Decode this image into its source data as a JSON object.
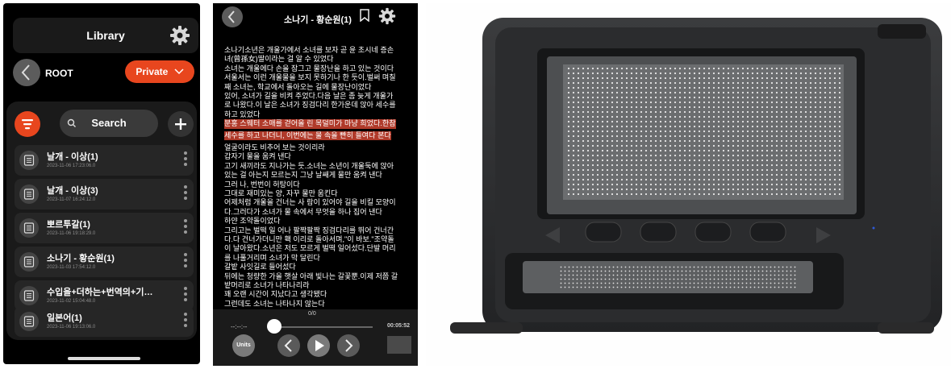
{
  "library": {
    "title": "Library",
    "root_label": "ROOT",
    "private_label": "Private",
    "search_label": "Search",
    "icons": [
      "gear-icon",
      "back-icon",
      "chevron-down-icon",
      "filter-icon",
      "search-icon",
      "plus-icon",
      "document-icon",
      "kebab-icon"
    ],
    "accent_color": "#e8461e",
    "items": [
      {
        "name": "날개 - 이상(1)",
        "date": "2023-11-06 17:23:06.0"
      },
      {
        "name": "날개 - 이상(3)",
        "date": "2023-11-07 16:24:12.0"
      },
      {
        "name": "뽀르투갈(1)",
        "date": "2023-11-06 19:18:29.0"
      },
      {
        "name": "소나기 - 황순원(1)",
        "date": "2023-11-03 17:54:12.0"
      },
      {
        "name": "수입을+더하는+번역의+기…",
        "date": "2023-11-02 15:04:48.0"
      },
      {
        "name": "일본어(1)",
        "date": "2023-11-06 19:13:06.0"
      }
    ]
  },
  "reader": {
    "title": "소나기 - 황순원(1)",
    "lines": [
      "소나기소년은 개울가에서 소녀를 보자 곧 윤 초시네 증손",
      "녀(曾孫女)딸이라는 걸 알 수 있었다",
      "소녀는 개울에다 손을 잠그고 물장난을 하고 있는 것이다",
      "서울서는 이런 개울물을 보지 못하기나 한 듯이.벌써 며칠",
      "째 소녀는, 학교에서 돌아오는 길에 물장난이었다",
      "있어, 소녀가 길을 비켜 주었다.다음 날은 좀 늦게 개울가",
      "로 나왔다.이 날은 소녀가 징검다리 한가운데 앉아 세수를",
      "하고 있었다",
      "분홍 스웨터 소매를 걷어올 린 목덜미가 마냥 희었다.한참",
      "세수를 하고 나더니, 이번에는 물 속을 빤히 들여다 본다",
      "얼굴이라도 비추어 보는 것이리라",
      "갑자기 물을 움켜 낸다",
      "고기 새끼라도 지나가는 듯.소녀는 소년이 개울둑에 앉아",
      "있는 걸 아는지 모르는지 그냥 날쌔게 물만 움켜 낸다",
      "그러 나, 번번이 허탕이다",
      "그대로 재미있는 양, 자꾸 물만 움킨다",
      "어제처럼 개울을 건너는 사 람이 있어야 길을 비킬 모양이",
      "다.그러다가 소녀가 물 속에서 무엇을 하나 집어 낸다",
      "하얀 조약돌이었다",
      "그리고는 벌떡 일 어나 팔짝팔짝 징검다리를 뛰어 건너간",
      "다.다 건너가더니만 홱 이리로 돌아서며,\"이 바보.\"조약돌",
      "이 날아왔다.소년은 저도 모르게 벌떡 일어섰다.단발 머리",
      "를 나풀거리며 소녀가 막 달린다",
      "갈밭 사잇길로 들어섰다",
      "뒤에는 청량한 가을 햇살 아래 빛나는 갈꽃뿐.이제 저쯤 갈",
      "밭머리로 소녀가 나타나리라",
      "꽤 오랜 시간이 지났다고 생각됐다",
      "그런데도 소녀는 나타나지 않는다"
    ],
    "highlighted_lines": [
      8,
      9
    ],
    "highlight_color": "#b03a2a",
    "position_label": "0/0",
    "time_elapsed": "--:--:--",
    "time_total": "00:05:52",
    "units_label": "Units",
    "playback_progress": 0.0,
    "icons": [
      "back-icon",
      "bookmark-icon",
      "gear-icon",
      "previous-icon",
      "play-icon",
      "next-icon"
    ]
  },
  "photo": {
    "subject": "braille display tablet device"
  }
}
